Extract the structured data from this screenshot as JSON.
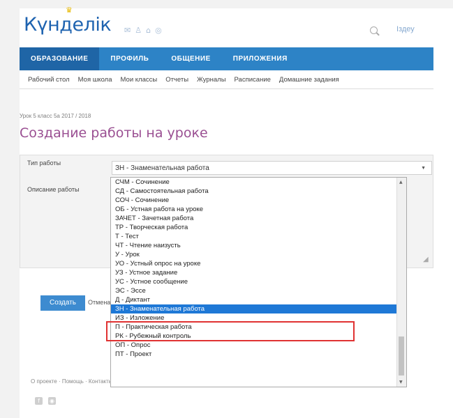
{
  "header": {
    "logo_text": "Күнделік",
    "logo_crown": "♛",
    "top_icons": [
      "message-icon",
      "person-icon",
      "home-icon",
      "globe-icon"
    ],
    "search_link": "Іздеу"
  },
  "nav": {
    "tabs": [
      {
        "label": "ОБРАЗОВАНИЕ",
        "active": true
      },
      {
        "label": "ПРОФИЛЬ",
        "active": false
      },
      {
        "label": "ОБЩЕНИЕ",
        "active": false
      },
      {
        "label": "ПРИЛОЖЕНИЯ",
        "active": false
      }
    ]
  },
  "subnav": {
    "items": [
      "Рабочий стол",
      "Моя школа",
      "Мои классы",
      "Отчеты",
      "Журналы",
      "Расписание",
      "Домашние задания"
    ]
  },
  "breadcrumb": "Урок 5 класс 5а 2017 / 2018",
  "page_title": "Создание работы на уроке",
  "form": {
    "type_label": "Тип работы",
    "select_value": "ЗН - Знаменательная работа",
    "description_label": "Описание работы"
  },
  "dropdown": {
    "options": [
      {
        "label": "СЧМ - Сочинение",
        "selected": false
      },
      {
        "label": "СД - Самостоятельная работа",
        "selected": false
      },
      {
        "label": "СОЧ - Сочинение",
        "selected": false
      },
      {
        "label": "ОБ - Устная работа на уроке",
        "selected": false
      },
      {
        "label": "ЗАЧЕТ - Зачетная работа",
        "selected": false
      },
      {
        "label": "ТР - Творческая работа",
        "selected": false
      },
      {
        "label": "Т - Тест",
        "selected": false
      },
      {
        "label": "ЧТ - Чтение наизусть",
        "selected": false
      },
      {
        "label": "У - Урок",
        "selected": false
      },
      {
        "label": "УО - Устный опрос на уроке",
        "selected": false
      },
      {
        "label": "УЗ - Устное задание",
        "selected": false
      },
      {
        "label": "УС - Устное сообщение",
        "selected": false
      },
      {
        "label": "ЭС - Эссе",
        "selected": false
      },
      {
        "label": "Д - Диктант",
        "selected": false
      },
      {
        "label": "ЗН - Знаменательная работа",
        "selected": true
      },
      {
        "label": "ИЗ - Изложение",
        "selected": false
      },
      {
        "label": "П - Практическая работа",
        "selected": false
      },
      {
        "label": "РК - Рубежный контроль",
        "selected": false
      },
      {
        "label": "ОП - Опрос",
        "selected": false
      },
      {
        "label": "ПТ - Проект",
        "selected": false
      }
    ]
  },
  "buttons": {
    "create": "Создать",
    "cancel": "Отмена"
  },
  "footer": {
    "links": "О проекте · Помощь · Контакты",
    "social_icons": [
      {
        "name": "facebook-icon",
        "glyph": "f"
      },
      {
        "name": "camera-icon",
        "glyph": "◉"
      }
    ]
  },
  "colors": {
    "nav_bg": "#2d83c6",
    "nav_active": "#1f65a6",
    "title": "#9a4f92",
    "selected_option": "#1e78d6",
    "highlight": "#e03232"
  }
}
